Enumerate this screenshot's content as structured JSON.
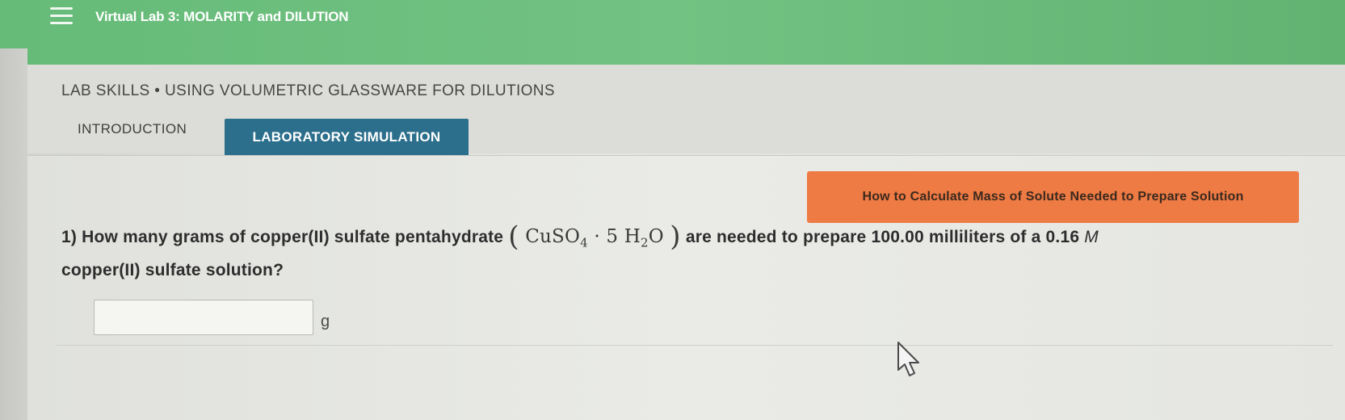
{
  "app": {
    "title": "Virtual Lab 3: MOLARITY and DILUTION",
    "menu_icon": "hamburger-menu-icon"
  },
  "lab": {
    "header": "LAB SKILLS • USING VOLUMETRIC GLASSWARE FOR DILUTIONS"
  },
  "tabs": [
    {
      "label": "INTRODUCTION",
      "active": false
    },
    {
      "label": "LABORATORY SIMULATION",
      "active": true
    }
  ],
  "help_button": {
    "label": "How to Calculate Mass of Solute Needed to Prepare Solution",
    "color": "#ee7a44"
  },
  "question": {
    "number": "1)",
    "text_before": "How many grams of copper(II) sulfate pentahydrate",
    "formula": {
      "part1": "CuSO",
      "sub1": "4",
      "dot": "·",
      "part2": "5 H",
      "sub2": "2",
      "part3": "O"
    },
    "text_middle": "are needed to prepare 100.00 milliliters of a 0.16",
    "molar_symbol": "M",
    "text_after": "copper(II) sulfate solution?"
  },
  "answer": {
    "value": "",
    "placeholder": "",
    "unit": "g"
  },
  "colors": {
    "topbar": "#6abd7b",
    "tab_active": "#2c6f8c"
  },
  "pointer_icon": "arrow-cursor-icon"
}
